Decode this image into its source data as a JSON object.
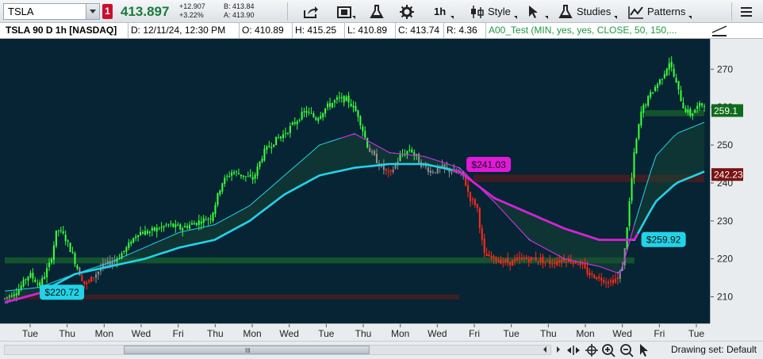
{
  "toolbar": {
    "symbol": "TSLA",
    "link_number": "1",
    "last_price": "413.897",
    "net_change": "+12.907",
    "percent_change": "+3.22%",
    "bid": "B: 413.84",
    "ask": "A: 413.90",
    "timeframe_label": "1h",
    "style_label": "Style",
    "studies_label": "Studies",
    "patterns_label": "Patterns"
  },
  "infobar": {
    "chart_title": "TSLA 90 D 1h [NASDAQ]",
    "date": "D: 12/11/24, 12:30 PM",
    "open": "O: 410.89",
    "high": "H: 415.25",
    "low": "L: 410.89",
    "close": "C: 413.74",
    "range": "R: 4.36",
    "study": "A00_Test (MIN, yes, yes, CLOSE, 50, 150,..."
  },
  "chart_data": {
    "type": "candlestick",
    "ylim": [
      203,
      278
    ],
    "y_ticks": [
      210,
      220,
      230,
      240,
      250,
      260,
      270
    ],
    "x_ticks": [
      "Tue",
      "Thu",
      "Mon",
      "Wed",
      "Fri",
      "Thu",
      "Mon",
      "Wed",
      "Tue",
      "Thu",
      "Mon",
      "Wed",
      "Fri",
      "Tue",
      "Thu",
      "Mon",
      "Wed",
      "Fri",
      "Tue"
    ],
    "price_labels": [
      {
        "text": "259.1",
        "value": 259.1,
        "color": "#0f6b1c"
      },
      {
        "text": "242.23",
        "value": 242.23,
        "color": "#7a1212"
      }
    ],
    "callouts": [
      {
        "text": "$220.72",
        "value": 211.2,
        "color": "#22d3e8"
      },
      {
        "text": "$241.03",
        "value": 244.9,
        "color": "#e01ad8"
      },
      {
        "text": "$259.92",
        "value": 225.1,
        "color": "#22d3e8"
      }
    ],
    "zones": [
      {
        "from": 218.8,
        "to": 220.4,
        "color": "#1f7a2a"
      },
      {
        "from": 209.3,
        "to": 210.6,
        "color": "#6b1a1a"
      },
      {
        "from": 240.2,
        "to": 242.2,
        "color": "#6b1a1a"
      },
      {
        "from": 257.6,
        "to": 259.2,
        "color": "#1f7a2a"
      }
    ],
    "colors": {
      "up": "#3cff3c",
      "down": "#ff2a1a",
      "neutral": "#8f8f8f",
      "fast_avg": "#22d3e8",
      "slow_avg": "#e01ad8"
    },
    "price_path": [
      [
        0,
        209.5
      ],
      [
        0.02,
        212
      ],
      [
        0.035,
        216
      ],
      [
        0.05,
        213
      ],
      [
        0.065,
        219
      ],
      [
        0.075,
        228
      ],
      [
        0.085,
        226
      ],
      [
        0.095,
        222
      ],
      [
        0.105,
        217
      ],
      [
        0.115,
        213
      ],
      [
        0.125,
        215
      ],
      [
        0.14,
        218
      ],
      [
        0.16,
        220
      ],
      [
        0.175,
        223
      ],
      [
        0.19,
        227
      ],
      [
        0.205,
        227
      ],
      [
        0.22,
        228
      ],
      [
        0.235,
        229
      ],
      [
        0.25,
        228
      ],
      [
        0.265,
        229
      ],
      [
        0.28,
        230
      ],
      [
        0.295,
        231
      ],
      [
        0.31,
        240
      ],
      [
        0.325,
        243
      ],
      [
        0.34,
        242
      ],
      [
        0.355,
        241
      ],
      [
        0.37,
        248
      ],
      [
        0.385,
        251
      ],
      [
        0.4,
        253
      ],
      [
        0.415,
        256
      ],
      [
        0.43,
        259
      ],
      [
        0.445,
        257
      ],
      [
        0.46,
        260
      ],
      [
        0.475,
        262
      ],
      [
        0.49,
        262
      ],
      [
        0.505,
        258
      ],
      [
        0.52,
        249
      ],
      [
        0.535,
        245
      ],
      [
        0.55,
        242
      ],
      [
        0.565,
        247
      ],
      [
        0.58,
        249
      ],
      [
        0.595,
        245
      ],
      [
        0.61,
        243
      ],
      [
        0.625,
        244
      ],
      [
        0.64,
        243
      ],
      [
        0.655,
        242
      ],
      [
        0.665,
        236
      ],
      [
        0.675,
        234
      ],
      [
        0.685,
        221
      ],
      [
        0.7,
        220
      ],
      [
        0.72,
        219
      ],
      [
        0.74,
        220
      ],
      [
        0.76,
        220
      ],
      [
        0.78,
        219
      ],
      [
        0.8,
        220
      ],
      [
        0.82,
        219
      ],
      [
        0.835,
        216
      ],
      [
        0.85,
        215
      ],
      [
        0.865,
        214
      ],
      [
        0.878,
        215
      ],
      [
        0.885,
        220
      ],
      [
        0.893,
        235
      ],
      [
        0.9,
        248
      ],
      [
        0.91,
        259
      ],
      [
        0.925,
        264
      ],
      [
        0.94,
        268
      ],
      [
        0.95,
        272
      ],
      [
        0.96,
        266
      ],
      [
        0.97,
        260
      ],
      [
        0.98,
        258
      ],
      [
        0.99,
        260
      ],
      [
        1.0,
        261
      ]
    ],
    "fast_avg": [
      [
        0,
        208.5
      ],
      [
        0.05,
        211
      ],
      [
        0.1,
        216
      ],
      [
        0.15,
        218
      ],
      [
        0.2,
        220
      ],
      [
        0.25,
        223
      ],
      [
        0.3,
        225
      ],
      [
        0.35,
        230
      ],
      [
        0.4,
        237
      ],
      [
        0.45,
        242
      ],
      [
        0.5,
        244
      ],
      [
        0.55,
        245
      ],
      [
        0.6,
        245
      ],
      [
        0.65,
        243
      ],
      [
        0.7,
        236
      ],
      [
        0.75,
        232
      ],
      [
        0.8,
        228
      ],
      [
        0.85,
        225
      ],
      [
        0.9,
        225
      ],
      [
        0.93,
        235
      ],
      [
        0.96,
        240
      ],
      [
        1.0,
        243
      ]
    ],
    "slow_avg": [
      [
        0,
        211.5
      ],
      [
        0.05,
        212.5
      ],
      [
        0.1,
        216
      ],
      [
        0.15,
        219
      ],
      [
        0.2,
        223
      ],
      [
        0.25,
        227
      ],
      [
        0.3,
        229
      ],
      [
        0.35,
        234
      ],
      [
        0.4,
        242
      ],
      [
        0.45,
        250
      ],
      [
        0.5,
        253
      ],
      [
        0.55,
        248
      ],
      [
        0.6,
        247
      ],
      [
        0.65,
        244
      ],
      [
        0.7,
        235
      ],
      [
        0.75,
        225
      ],
      [
        0.8,
        220
      ],
      [
        0.85,
        218
      ],
      [
        0.88,
        216
      ],
      [
        0.9,
        229
      ],
      [
        0.93,
        247
      ],
      [
        0.96,
        253
      ],
      [
        1.0,
        256
      ]
    ]
  },
  "bottombar": {
    "drawing_set": "Drawing set: Default"
  }
}
